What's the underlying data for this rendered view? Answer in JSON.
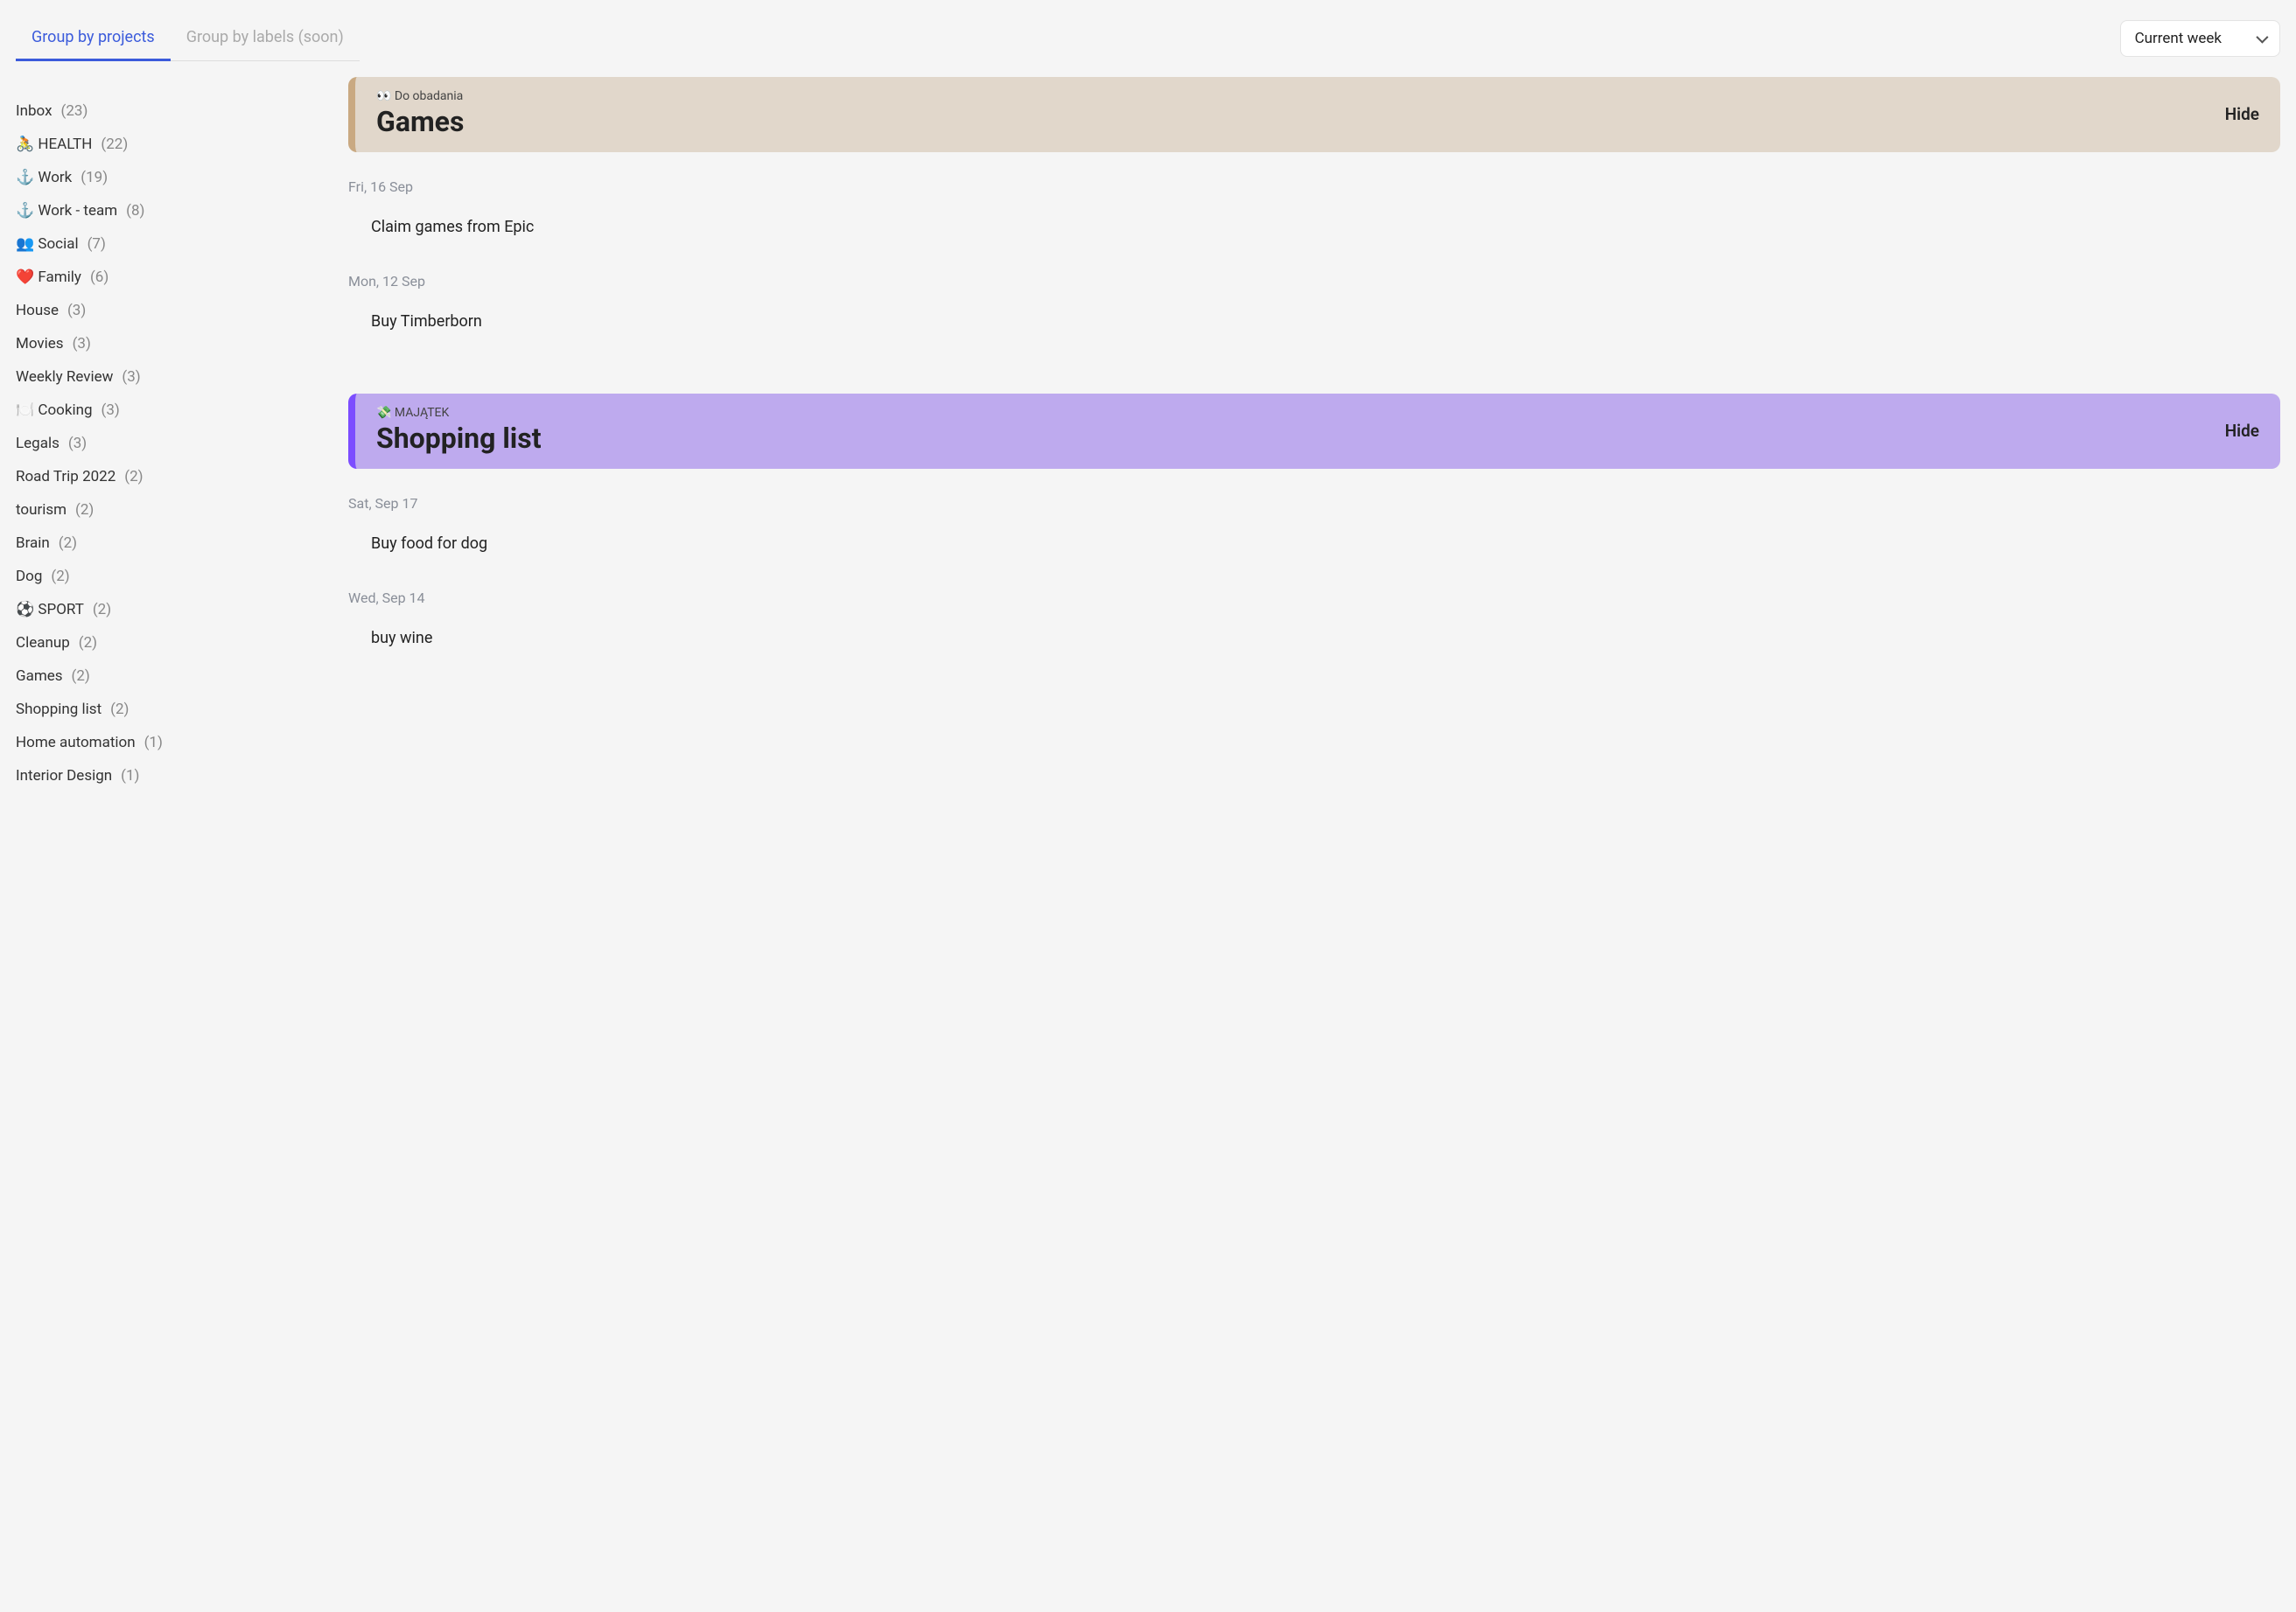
{
  "tabs": {
    "group_projects": "Group by projects",
    "group_labels": "Group by labels (soon)"
  },
  "period_selector": {
    "value": "Current week"
  },
  "sidebar": {
    "items": [
      {
        "label": "Inbox",
        "count": "(23)"
      },
      {
        "label": "🚴 HEALTH",
        "count": "(22)"
      },
      {
        "label": "⚓ Work",
        "count": "(19)"
      },
      {
        "label": "⚓ Work - team",
        "count": "(8)"
      },
      {
        "label": "👥 Social",
        "count": "(7)"
      },
      {
        "label": "❤️ Family",
        "count": "(6)"
      },
      {
        "label": "House",
        "count": "(3)"
      },
      {
        "label": "Movies",
        "count": "(3)"
      },
      {
        "label": "Weekly Review",
        "count": "(3)"
      },
      {
        "label": "🍽️ Cooking",
        "count": "(3)"
      },
      {
        "label": "Legals",
        "count": "(3)"
      },
      {
        "label": "Road Trip 2022",
        "count": "(2)"
      },
      {
        "label": "tourism",
        "count": "(2)"
      },
      {
        "label": "Brain",
        "count": "(2)"
      },
      {
        "label": "Dog",
        "count": "(2)"
      },
      {
        "label": "⚽ SPORT",
        "count": "(2)"
      },
      {
        "label": "Cleanup",
        "count": "(2)"
      },
      {
        "label": "Games",
        "count": "(2)"
      },
      {
        "label": "Shopping list",
        "count": "(2)"
      },
      {
        "label": "Home automation",
        "count": "(1)"
      },
      {
        "label": "Interior Design",
        "count": "(1)"
      }
    ]
  },
  "sections": [
    {
      "meta": "👀 Do obadania",
      "title": "Games",
      "hide": "Hide",
      "color": "tan",
      "groups": [
        {
          "date": "Fri, 16 Sep",
          "tasks": [
            "Claim games from Epic"
          ]
        },
        {
          "date": "Mon, 12 Sep",
          "tasks": [
            "Buy Timberborn"
          ]
        }
      ]
    },
    {
      "meta": "💸 MAJĄTEK",
      "title": "Shopping list",
      "hide": "Hide",
      "color": "purple",
      "groups": [
        {
          "date": "Sat, Sep 17",
          "tasks": [
            "Buy food for dog"
          ]
        },
        {
          "date": "Wed, Sep 14",
          "tasks": [
            "buy wine"
          ]
        }
      ]
    }
  ]
}
